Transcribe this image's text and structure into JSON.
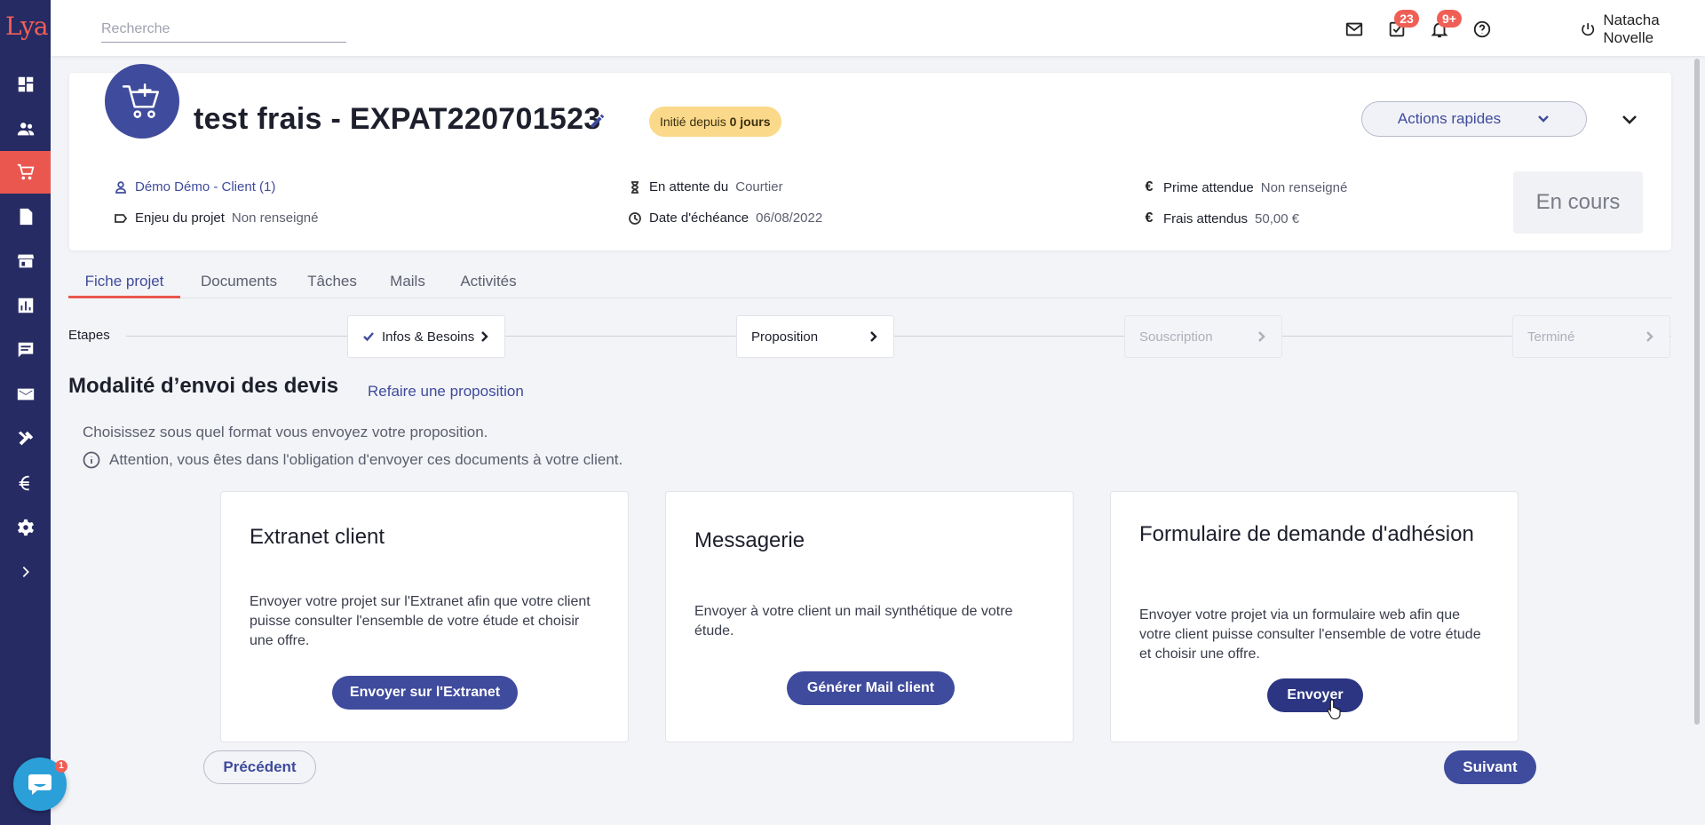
{
  "app": {
    "logo_text": "Lya"
  },
  "sidebar": {
    "items": [
      {
        "icon": "dashboard-icon"
      },
      {
        "icon": "users-icon"
      },
      {
        "icon": "cart-icon",
        "active": true
      },
      {
        "icon": "document-icon"
      },
      {
        "icon": "store-icon"
      },
      {
        "icon": "chart-icon"
      },
      {
        "icon": "chat-icon"
      },
      {
        "icon": "mail-icon"
      },
      {
        "icon": "tools-icon"
      },
      {
        "icon": "euro-icon"
      },
      {
        "icon": "gear-icon"
      },
      {
        "icon": "chevron-right-icon"
      }
    ]
  },
  "topbar": {
    "search_placeholder": "Recherche",
    "tasks_badge": "23",
    "notifications_badge": "9+",
    "user_name": "Natacha Novelle"
  },
  "project": {
    "title": "test frais - EXPAT220701523",
    "status_pill_prefix": "Initié depuis",
    "status_pill_value": "0 jours",
    "quick_actions_label": "Actions rapides",
    "client_link": "Démo Démo - Client (1)",
    "stake_label": "Enjeu du projet",
    "stake_value": "Non renseigné",
    "waiting_label": "En attente du",
    "waiting_value": "Courtier",
    "due_label": "Date d'échéance",
    "due_value": "06/08/2022",
    "premium_label": "Prime attendue",
    "premium_value": "Non renseigné",
    "fees_label": "Frais attendus",
    "fees_value": "50,00 €",
    "state": "En cours"
  },
  "tabs": [
    {
      "label": "Fiche projet",
      "active": true
    },
    {
      "label": "Documents"
    },
    {
      "label": "Tâches"
    },
    {
      "label": "Mails"
    },
    {
      "label": "Activités"
    }
  ],
  "stepper": {
    "label": "Etapes",
    "steps": [
      {
        "label": "Infos & Besoins",
        "done": true
      },
      {
        "label": "Proposition"
      },
      {
        "label": "Souscription",
        "disabled": true
      },
      {
        "label": "Terminé",
        "disabled": true
      }
    ]
  },
  "section": {
    "title": "Modalité d’envoi des devis",
    "redo_link": "Refaire une proposition",
    "intro": "Choisissez sous quel format vous envoyez votre proposition.",
    "warning": "Attention, vous êtes dans l'obligation d'envoyer ces documents à votre client."
  },
  "options": [
    {
      "title": "Extranet client",
      "description": "Envoyer votre projet sur l'Extranet afin que votre client puisse consulter l'ensemble de votre étude et choisir une offre.",
      "button": "Envoyer sur l'Extranet"
    },
    {
      "title": "Messagerie",
      "description": "Envoyer à votre client un mail synthétique de votre étude.",
      "button": "Générer Mail client"
    },
    {
      "title": "Formulaire de demande d'adhésion",
      "description": "Envoyer votre projet via un formulaire web afin que votre client puisse consulter l'ensemble de votre étude et choisir une offre.",
      "button": "Envoyer"
    }
  ],
  "navigation": {
    "previous": "Précédent",
    "next": "Suivant"
  },
  "chat": {
    "badge": "1"
  },
  "colors": {
    "brand": "#262b63",
    "accent": "#e9574f",
    "primary": "#3f4b9c",
    "pill": "#fbd98a"
  }
}
